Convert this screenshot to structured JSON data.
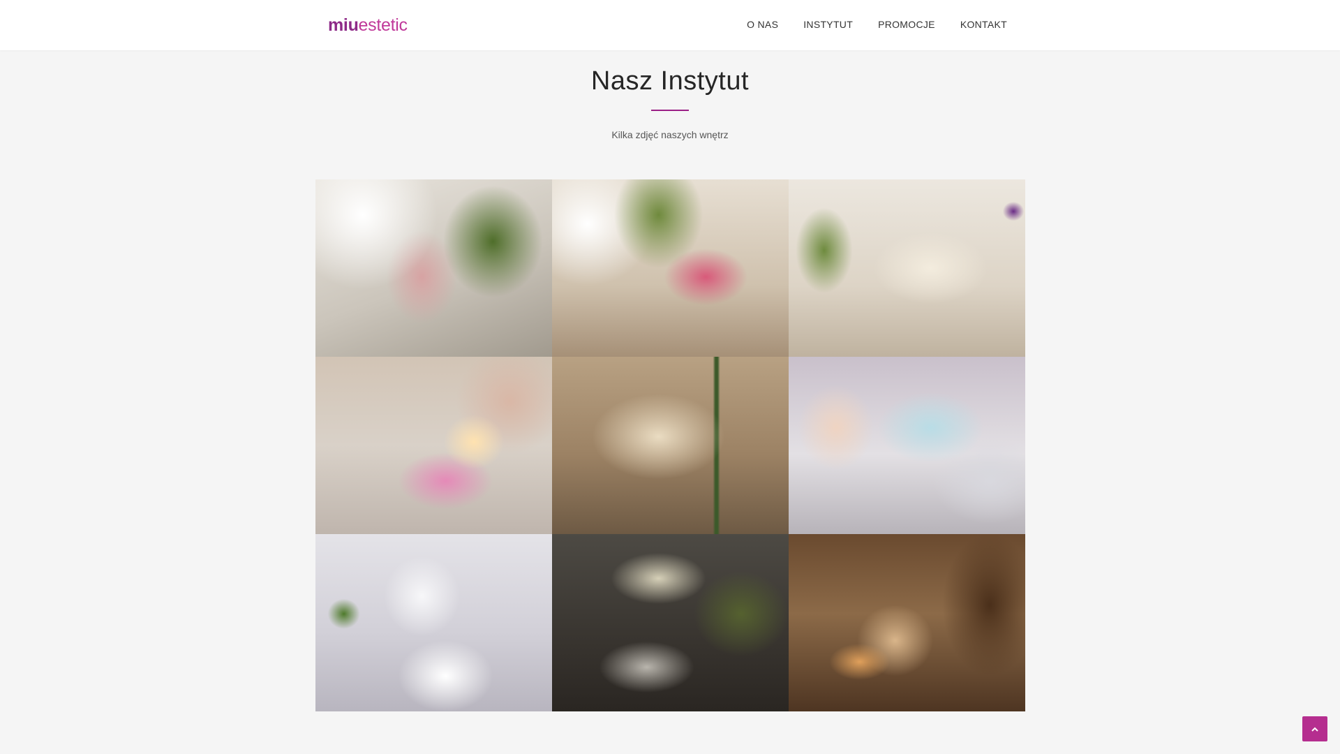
{
  "brand": {
    "logo_strong": "miu",
    "logo_light": "estetic"
  },
  "nav": {
    "items": [
      {
        "label": "O NAS"
      },
      {
        "label": "INSTYTUT"
      },
      {
        "label": "PROMOCJE"
      },
      {
        "label": "KONTAKT"
      }
    ]
  },
  "section": {
    "title": "Nasz Instytut",
    "subtitle": "Kilka zdjęć naszych wnętrz"
  },
  "gallery": {
    "photos": [
      "magazine-rack-plant-photo",
      "flower-bouquet-photo",
      "lounge-chairs-photo",
      "candle-brochures-photo",
      "cosmetic-bottles-photo",
      "geneo-poster-photo",
      "treatment-room-photo",
      "beauty-device-photo",
      "relax-room-photo"
    ]
  },
  "colors": {
    "accent": "#b52e8f",
    "logo_dark": "#8e2a88",
    "divider": "#9b1f86",
    "background": "#f5f5f5"
  },
  "icons": {
    "scroll_top": "chevron-up-icon"
  }
}
